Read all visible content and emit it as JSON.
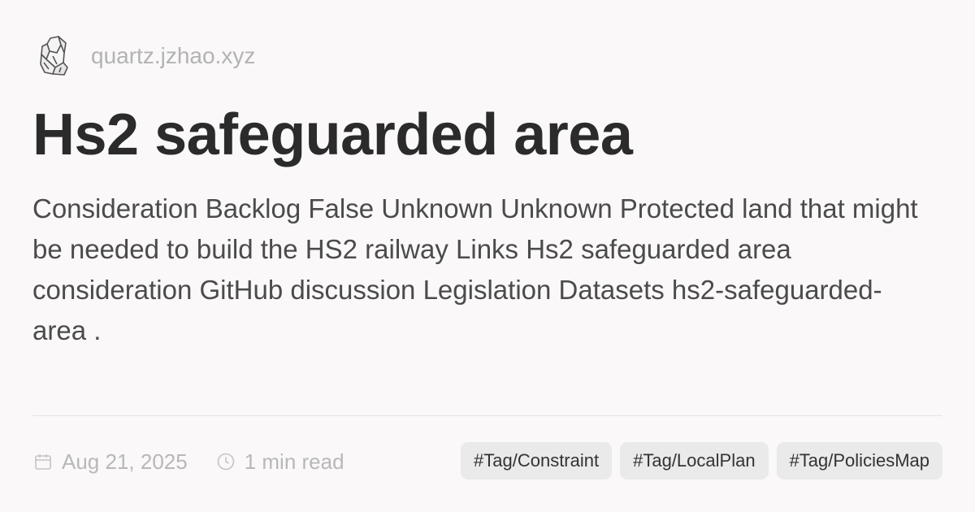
{
  "site": {
    "name": "quartz.jzhao.xyz",
    "logo_icon": "crystal-logo-icon"
  },
  "page": {
    "title": "Hs2 safeguarded area",
    "description": "Consideration Backlog False Unknown Unknown Protected land that might be needed to build the HS2 railway Links Hs2 safeguarded area consideration GitHub discussion Legislation Datasets hs2-safeguarded-area ."
  },
  "meta": {
    "date": "Aug 21, 2025",
    "date_icon": "calendar-icon",
    "reading_time": "1 min read",
    "reading_time_icon": "clock-icon"
  },
  "tags": [
    {
      "label": "#Tag/Constraint"
    },
    {
      "label": "#Tag/LocalPlan"
    },
    {
      "label": "#Tag/PoliciesMap"
    }
  ],
  "colors": {
    "background": "#faf8f8",
    "title": "#2b2b2b",
    "description": "#4b4b4b",
    "muted": "#b8b8b8",
    "tag_background": "#eaeaea",
    "divider": "#e5e5e5"
  }
}
